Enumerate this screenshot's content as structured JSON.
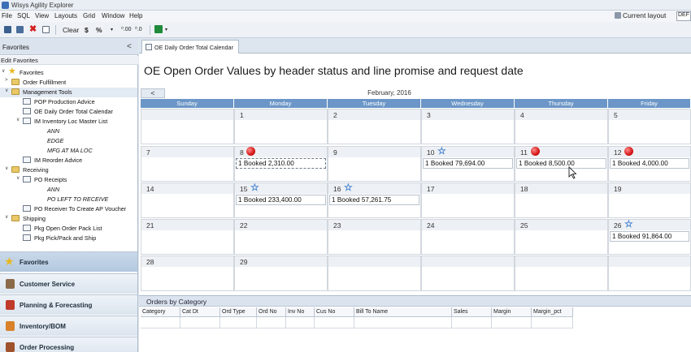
{
  "window": {
    "title": "Wisys Agility Explorer"
  },
  "menu": [
    "File",
    "SQL",
    "View",
    "Layouts",
    "Grid",
    "Window",
    "Help"
  ],
  "current_layout": {
    "label": "Current layout",
    "value": "DEF"
  },
  "toolbar": {
    "clear_label": "Clear",
    "dollar_label": "$",
    "percent_label": "%",
    "dec_inc_label": "⁰.00",
    "dec_dec_label": "⁰.0"
  },
  "sidebar": {
    "header": "Favorites",
    "collapse_glyph": "<",
    "edit_favorites": "Edit Favorites",
    "tree": [
      {
        "label": "Favorites",
        "icon": "star-icon",
        "arrow": "v"
      },
      {
        "label": "Order Fulfillment",
        "icon": "folder-icon",
        "arrow": ">"
      },
      {
        "label": "Management Tools",
        "icon": "folder-icon",
        "arrow": "v"
      },
      {
        "label": "POP Production Advice",
        "icon": "report-icon"
      },
      {
        "label": "OE Daily Order Total Calendar",
        "icon": "calendar-icon"
      },
      {
        "label": "IM Inventory Loc Master List",
        "icon": "report-icon",
        "arrow": "v"
      },
      {
        "label": "ANN",
        "italic": true
      },
      {
        "label": "EDGE",
        "italic": true
      },
      {
        "label": "MFG AT MA LOC",
        "italic": true
      },
      {
        "label": "IM Reorder Advice",
        "icon": "report-icon"
      },
      {
        "label": "Receiving",
        "icon": "folder-icon",
        "arrow": "v"
      },
      {
        "label": "PO Receipts",
        "icon": "report-icon",
        "arrow": "v"
      },
      {
        "label": "ANN",
        "italic": true
      },
      {
        "label": "PO LEFT TO RECEIVE",
        "italic": true
      },
      {
        "label": "PO Receiver To Create AP Voucher",
        "icon": "report-icon"
      },
      {
        "label": "Shipping",
        "icon": "folder-icon",
        "arrow": "v"
      },
      {
        "label": "Pkg Open Order Pack List",
        "icon": "report-icon"
      },
      {
        "label": "Pkg Pick/Pack and Ship",
        "icon": "report-icon"
      }
    ],
    "nav_buttons": [
      {
        "label": "Favorites",
        "icon": "star-icon",
        "color": "#e8b820"
      },
      {
        "label": "Customer Service",
        "icon": "customer-service-icon",
        "color": "#8a6a48"
      },
      {
        "label": "Planning & Forecasting",
        "icon": "calendar-icon",
        "color": "#c0392b"
      },
      {
        "label": "Inventory/BOM",
        "icon": "inventory-icon",
        "color": "#d9822b"
      },
      {
        "label": "Order Processing",
        "icon": "order-icon",
        "color": "#a0522d"
      }
    ]
  },
  "document_tab": {
    "label": "OE Daily Order Total Calendar"
  },
  "report": {
    "title": "OE Open Order Values by header status and line promise and request date",
    "month": "February, 2016",
    "prev_glyph": "<",
    "days_of_week": [
      "Sunday",
      "Monday",
      "Tuesday",
      "Wednesday",
      "Thursday",
      "Friday"
    ],
    "weeks": [
      [
        {
          "day": ""
        },
        {
          "day": "1"
        },
        {
          "day": "2"
        },
        {
          "day": "3"
        },
        {
          "day": "4"
        },
        {
          "day": "5"
        }
      ],
      [
        {
          "day": "7"
        },
        {
          "day": "8",
          "flag": "red",
          "entry": "1 Booked 2,310.00"
        },
        {
          "day": "9"
        },
        {
          "day": "10",
          "flag": "star",
          "entry": "1 Booked 79,694.00"
        },
        {
          "day": "11",
          "flag": "red",
          "entry": "1 Booked 8,500.00"
        },
        {
          "day": "12",
          "flag": "red",
          "entry": "1 Booked 4,000.00"
        }
      ],
      [
        {
          "day": "14"
        },
        {
          "day": "15",
          "flag": "star",
          "entry": "1 Booked 233,400.00"
        },
        {
          "day": "16",
          "flag": "star",
          "entry": "1 Booked 57,261.75"
        },
        {
          "day": "17"
        },
        {
          "day": "18"
        },
        {
          "day": "19"
        }
      ],
      [
        {
          "day": "21"
        },
        {
          "day": "22"
        },
        {
          "day": "23"
        },
        {
          "day": "24"
        },
        {
          "day": "25"
        },
        {
          "day": "26",
          "flag": "star",
          "entry": "1 Booked 91,864.00"
        }
      ],
      [
        {
          "day": "28"
        },
        {
          "day": "29"
        },
        {
          "day": ""
        },
        {
          "day": ""
        },
        {
          "day": ""
        },
        {
          "day": ""
        }
      ]
    ]
  },
  "orders": {
    "title": "Orders by Category",
    "columns": [
      "Category",
      "Cat Dt",
      "Ord Type",
      "Ord No",
      "Inv No",
      "Cus No",
      "Bill To Name",
      "Sales",
      "Margin",
      "Margin_pct"
    ]
  },
  "colors": {
    "day_header": "#6b96c7",
    "red_flag": "#d41717",
    "star_flag": "#3f7fd0"
  }
}
